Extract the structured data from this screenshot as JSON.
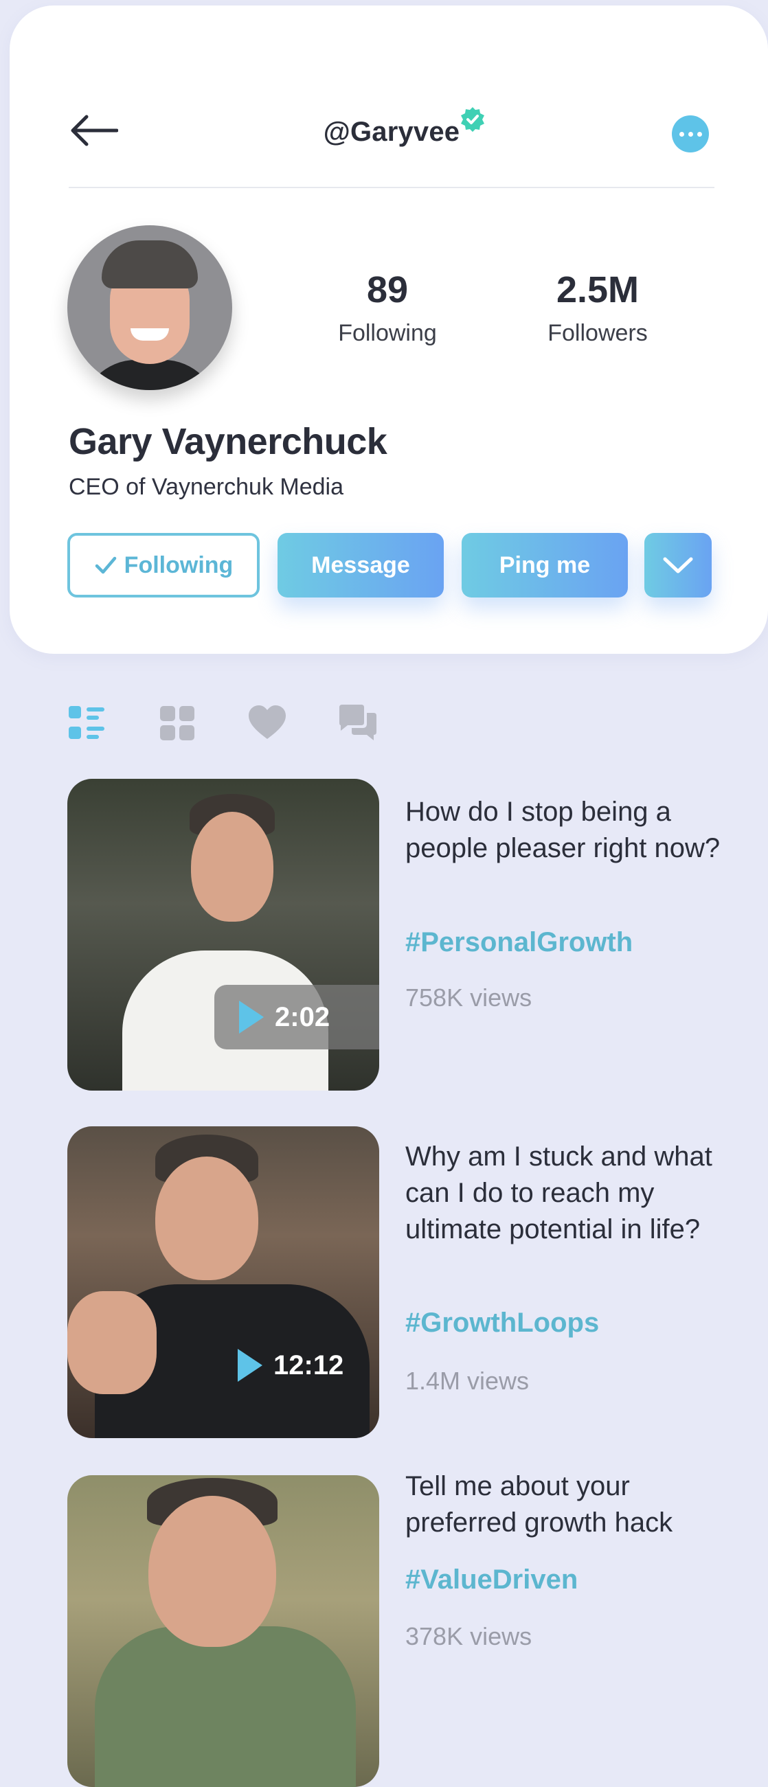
{
  "header": {
    "username": "@Garyvee",
    "verified": true
  },
  "profile": {
    "name": "Gary Vaynerchuck",
    "title": "CEO of Vaynerchuk Media",
    "stats": {
      "following_count": "89",
      "following_label": "Following",
      "followers_count": "2.5M",
      "followers_label": "Followers"
    }
  },
  "actions": {
    "following_label": "Following",
    "message_label": "Message",
    "ping_label": "Ping me"
  },
  "tabs": [
    {
      "name": "list-view",
      "active": true
    },
    {
      "name": "grid-view",
      "active": false
    },
    {
      "name": "liked",
      "active": false
    },
    {
      "name": "comments",
      "active": false
    }
  ],
  "posts": [
    {
      "title": "How do I stop being a people pleaser right now?",
      "tag": "#PersonalGrowth",
      "views": "758K views",
      "duration": "2:02"
    },
    {
      "title": "Why am I stuck and what can I do to reach my ultimate potential in life?",
      "tag": "#GrowthLoops",
      "views": "1.4M views",
      "duration": "12:12"
    },
    {
      "title": "Tell me about your preferred growth hack",
      "tag": "#ValueDriven",
      "views": "378K views",
      "duration": ""
    }
  ],
  "colors": {
    "accent": "#5ec3e8",
    "accent_gradient_end": "#6aa3f2",
    "tag": "#5cb6cf",
    "background": "#e7e9f7",
    "verified": "#3fd0b4"
  }
}
